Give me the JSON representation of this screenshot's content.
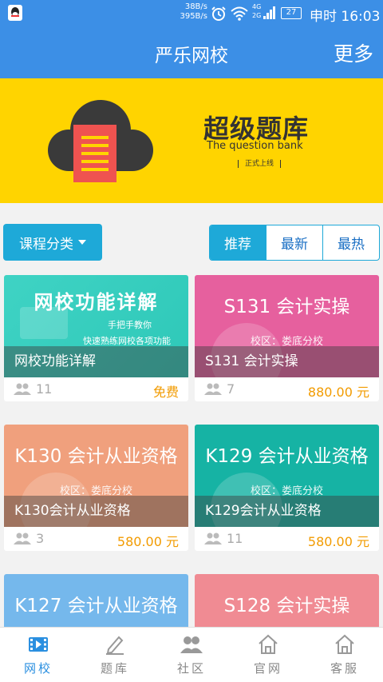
{
  "status_bar": {
    "net_up": "38B/s",
    "net_down": "395B/s",
    "signal_labels": [
      "4G",
      "2G"
    ],
    "battery": "27",
    "time": "申时 16:03"
  },
  "header": {
    "title": "严乐网校",
    "more": "更多"
  },
  "banner": {
    "title": "超级题库",
    "subtitle": "The question bank",
    "tag": "正式上线"
  },
  "filters": {
    "category_label": "课程分类",
    "tabs": [
      "推荐",
      "最新",
      "最热"
    ]
  },
  "courses": [
    {
      "image_title": "网校功能详解",
      "image_sub1": "手把手教你",
      "image_sub2": "快速熟练网校各项功能",
      "name": "网校功能详解",
      "students": "11",
      "price": "免费"
    },
    {
      "image_title": "S131 会计实操",
      "campus": "校区：娄底分校",
      "name": "S131 会计实操",
      "students": "7",
      "price": "880.00 元"
    },
    {
      "image_title": "K130 会计从业资格",
      "campus": "校区：娄底分校",
      "name": "K130会计从业资格",
      "students": "3",
      "price": "580.00 元"
    },
    {
      "image_title": "K129 会计从业资格",
      "campus": "校区：娄底分校",
      "name": "K129会计从业资格",
      "students": "11",
      "price": "580.00 元"
    },
    {
      "image_title": "K127 会计从业资格"
    },
    {
      "image_title": "S128 会计实操"
    }
  ],
  "colors": {
    "primary": "#3c8fe6",
    "accent": "#1ea9d8",
    "price": "#f29b00",
    "banner": "#ffd400"
  },
  "bottom_nav": [
    {
      "label": "网校",
      "icon": "film-icon",
      "active": true
    },
    {
      "label": "题库",
      "icon": "pen-icon",
      "active": false
    },
    {
      "label": "社区",
      "icon": "community-icon",
      "active": false
    },
    {
      "label": "官网",
      "icon": "home-icon",
      "active": false
    },
    {
      "label": "客服",
      "icon": "service-icon",
      "active": false
    }
  ]
}
